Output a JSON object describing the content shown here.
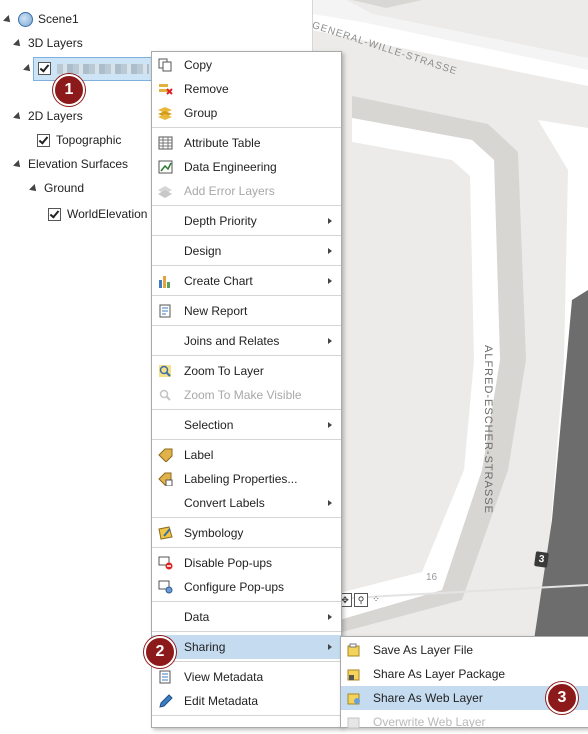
{
  "toc": {
    "scene": "Scene1",
    "group_3d": "3D Layers",
    "group_2d": "2D Layers",
    "layer_2d": "Topographic",
    "group_elev": "Elevation Surfaces",
    "ground": "Ground",
    "elev_layer": "WorldElevation"
  },
  "map": {
    "street_top": "GENERAL-WILLE-STRASSE",
    "street_right": "ALFRED-ESCHER-STRASSE",
    "number": "16",
    "shield": "3"
  },
  "badges": [
    "1",
    "2",
    "3"
  ],
  "context_menu": {
    "items": [
      {
        "label": "Copy",
        "icon": "copy-icon"
      },
      {
        "label": "Remove",
        "icon": "remove-icon"
      },
      {
        "label": "Group",
        "icon": "group-icon"
      },
      {
        "label": "Attribute Table",
        "icon": "table-icon"
      },
      {
        "label": "Data Engineering",
        "icon": "data-engineering-icon"
      },
      {
        "label": "Add Error Layers",
        "icon": "error-layers-icon",
        "disabled": true
      },
      {
        "label": "Depth Priority"
      },
      {
        "label": "Design"
      },
      {
        "label": "Create Chart",
        "icon": "chart-icon"
      },
      {
        "label": "New Report",
        "icon": "report-icon"
      },
      {
        "label": "Joins and Relates"
      },
      {
        "label": "Zoom To Layer",
        "icon": "zoom-icon"
      },
      {
        "label": "Zoom To Make Visible",
        "icon": "zoom-visible-icon",
        "disabled": true
      },
      {
        "label": "Selection"
      },
      {
        "label": "Label",
        "icon": "label-icon"
      },
      {
        "label": "Labeling Properties...",
        "icon": "labeling-properties-icon"
      },
      {
        "label": "Convert Labels"
      },
      {
        "label": "Symbology",
        "icon": "symbology-icon"
      },
      {
        "label": "Disable Pop-ups",
        "icon": "disable-popups-icon"
      },
      {
        "label": "Configure Pop-ups",
        "icon": "configure-popups-icon"
      },
      {
        "label": "Data"
      },
      {
        "label": "Sharing"
      },
      {
        "label": "View Metadata",
        "icon": "view-metadata-icon"
      },
      {
        "label": "Edit Metadata",
        "icon": "edit-metadata-icon"
      }
    ]
  },
  "sharing_submenu": {
    "items": [
      {
        "label": "Save As Layer File"
      },
      {
        "label": "Share As Layer Package"
      },
      {
        "label": "Share As Web Layer"
      },
      {
        "label": "Overwrite Web Layer",
        "disabled": true
      }
    ]
  },
  "colors": {
    "highlight": "#c5dcf0",
    "badge": "#8d1a1a",
    "map_bg": "#ecebe9"
  }
}
